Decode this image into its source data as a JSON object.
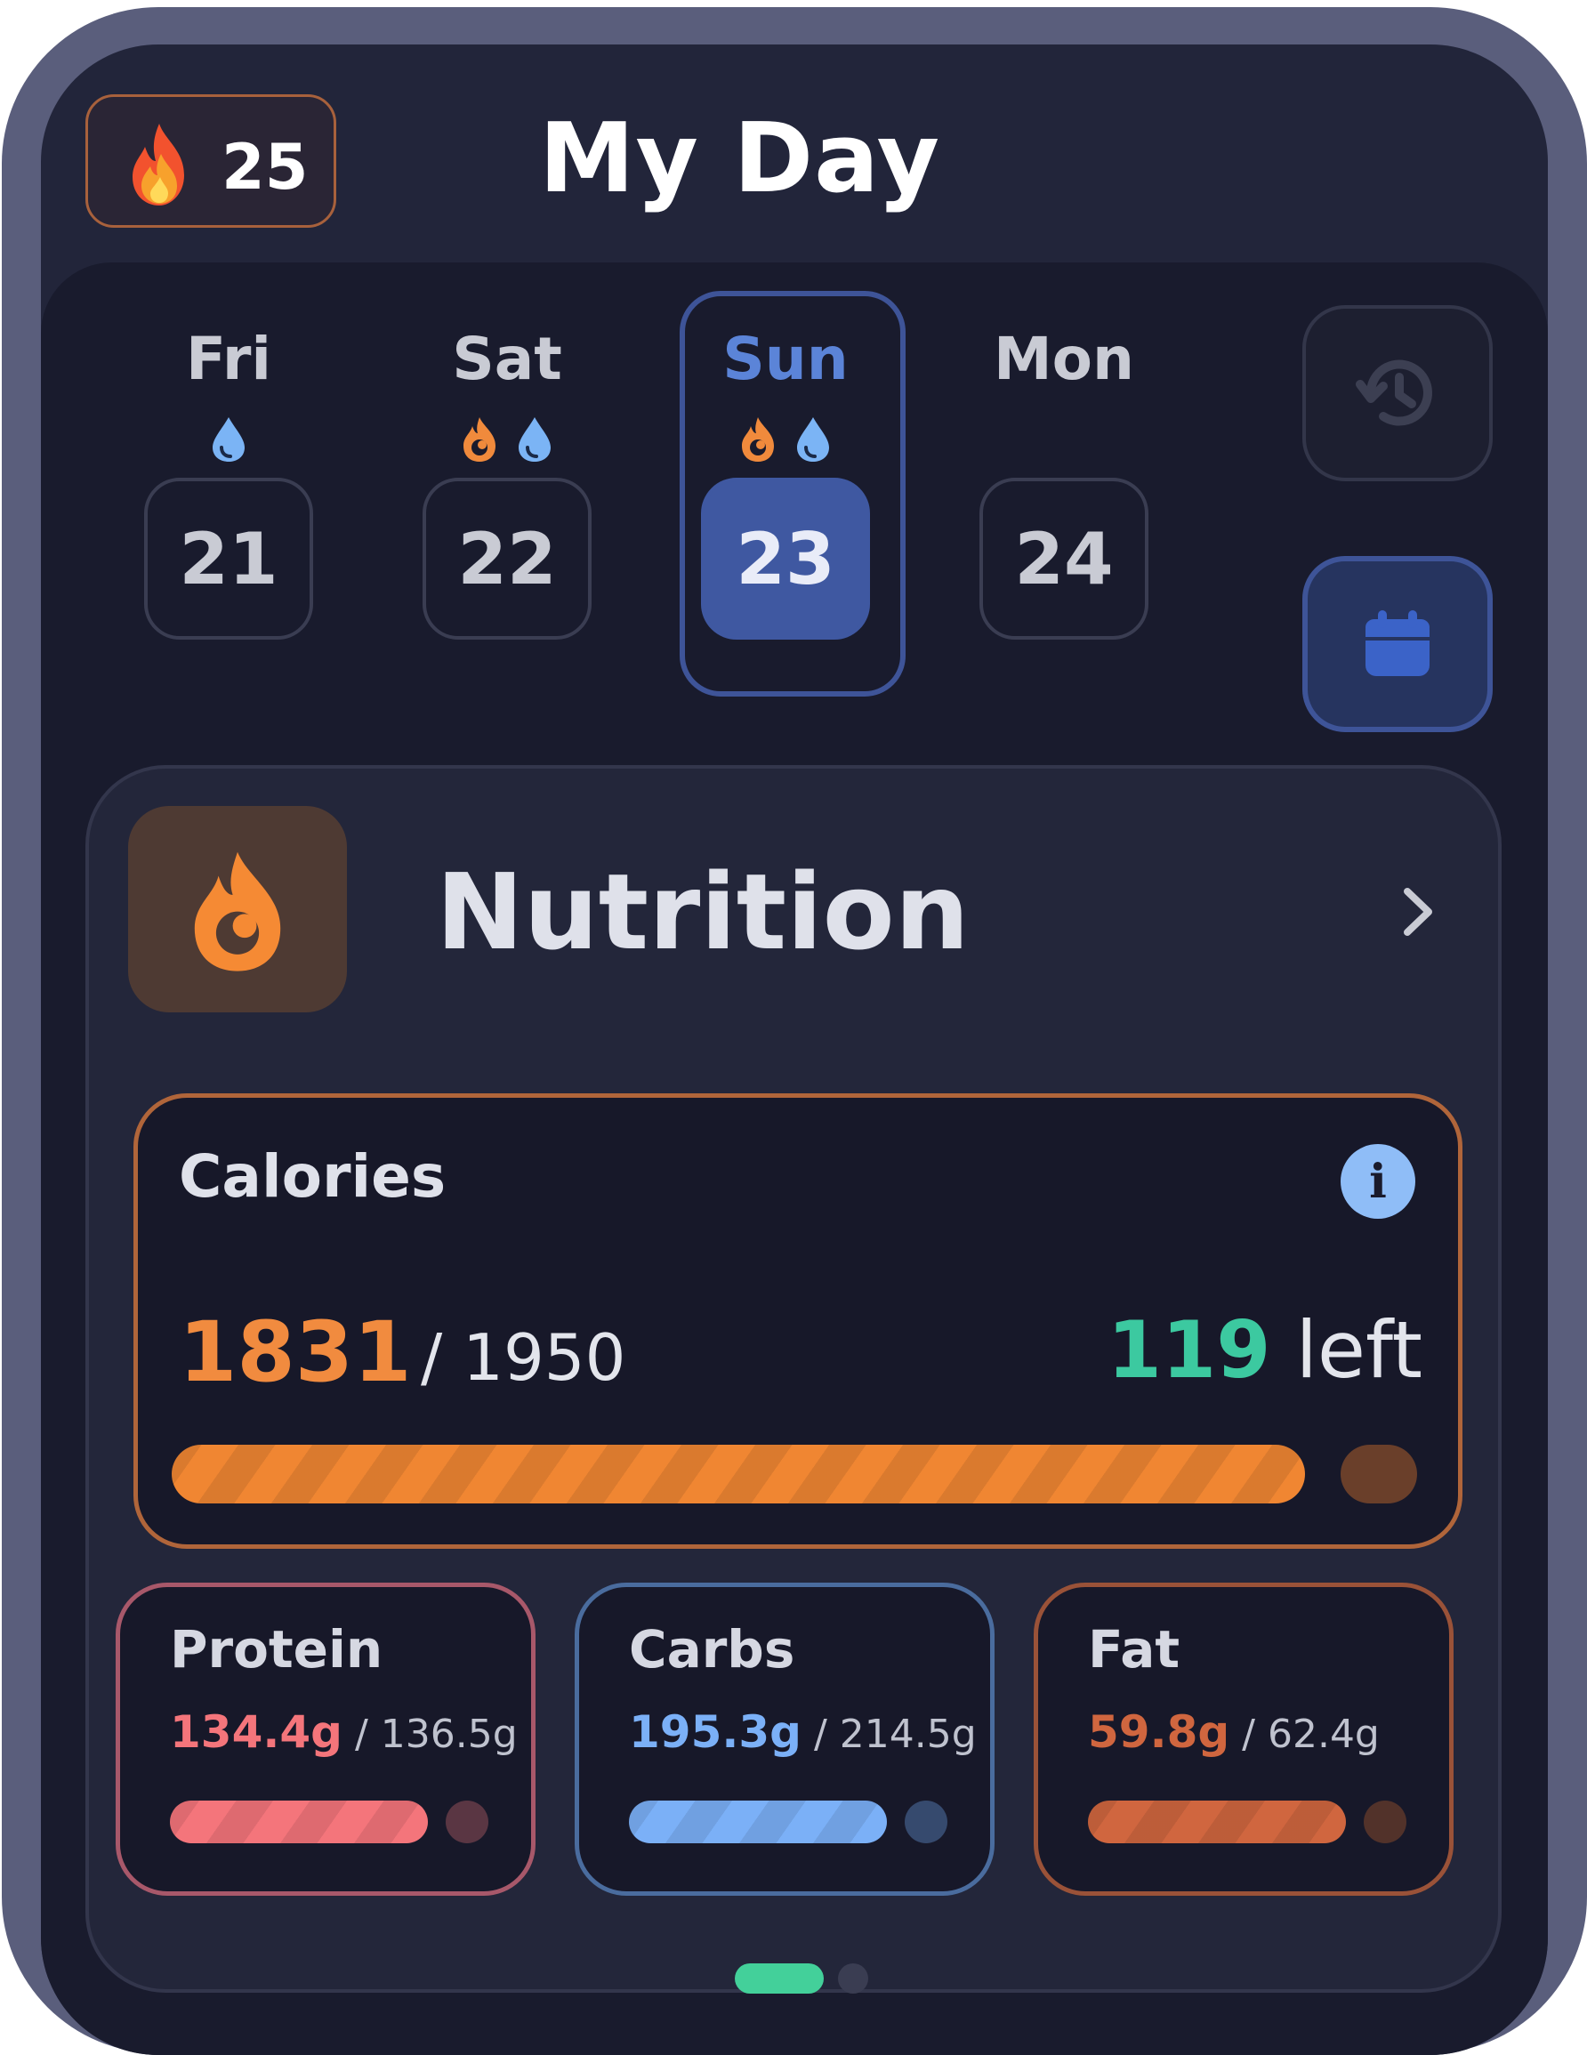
{
  "header": {
    "streak_count": "25",
    "title": "My Day"
  },
  "days": [
    {
      "name": "Fri",
      "date": "21",
      "icons": [
        "water-drop-icon"
      ],
      "selected": false
    },
    {
      "name": "Sat",
      "date": "22",
      "icons": [
        "flame-icon",
        "water-drop-icon"
      ],
      "selected": false
    },
    {
      "name": "Sun",
      "date": "23",
      "icons": [
        "flame-icon",
        "water-drop-icon"
      ],
      "selected": true
    },
    {
      "name": "Mon",
      "date": "24",
      "icons": [],
      "selected": false
    }
  ],
  "nutrition": {
    "title": "Nutrition",
    "calories": {
      "label": "Calories",
      "consumed": "1831",
      "goal": "/ 1950",
      "left_value": "119",
      "left_word": "left",
      "progress_fraction": 0.939
    },
    "macros": [
      {
        "name": "Protein",
        "current": "134.4g",
        "goal": "/ 136.5g",
        "progress_fraction": 0.985,
        "color": "#f4757b",
        "border": "#a8586a",
        "dot": "#5a3643"
      },
      {
        "name": "Carbs",
        "current": "195.3g",
        "goal": "/ 214.5g",
        "progress_fraction": 0.91,
        "color": "#7bb0f7",
        "border": "#4a6c9e",
        "dot": "#364a6e"
      },
      {
        "name": "Fat",
        "current": "59.8g",
        "goal": "/ 62.4g",
        "progress_fraction": 0.958,
        "color": "#d0663f",
        "border": "#9a5238",
        "dot": "#52322a"
      }
    ]
  },
  "pager": {
    "pages": 2,
    "active": 0
  },
  "colors": {
    "accent_orange": "#f18b3f",
    "accent_green": "#3cc9a0",
    "accent_blue": "#3f58a1",
    "background": "#22253a"
  }
}
